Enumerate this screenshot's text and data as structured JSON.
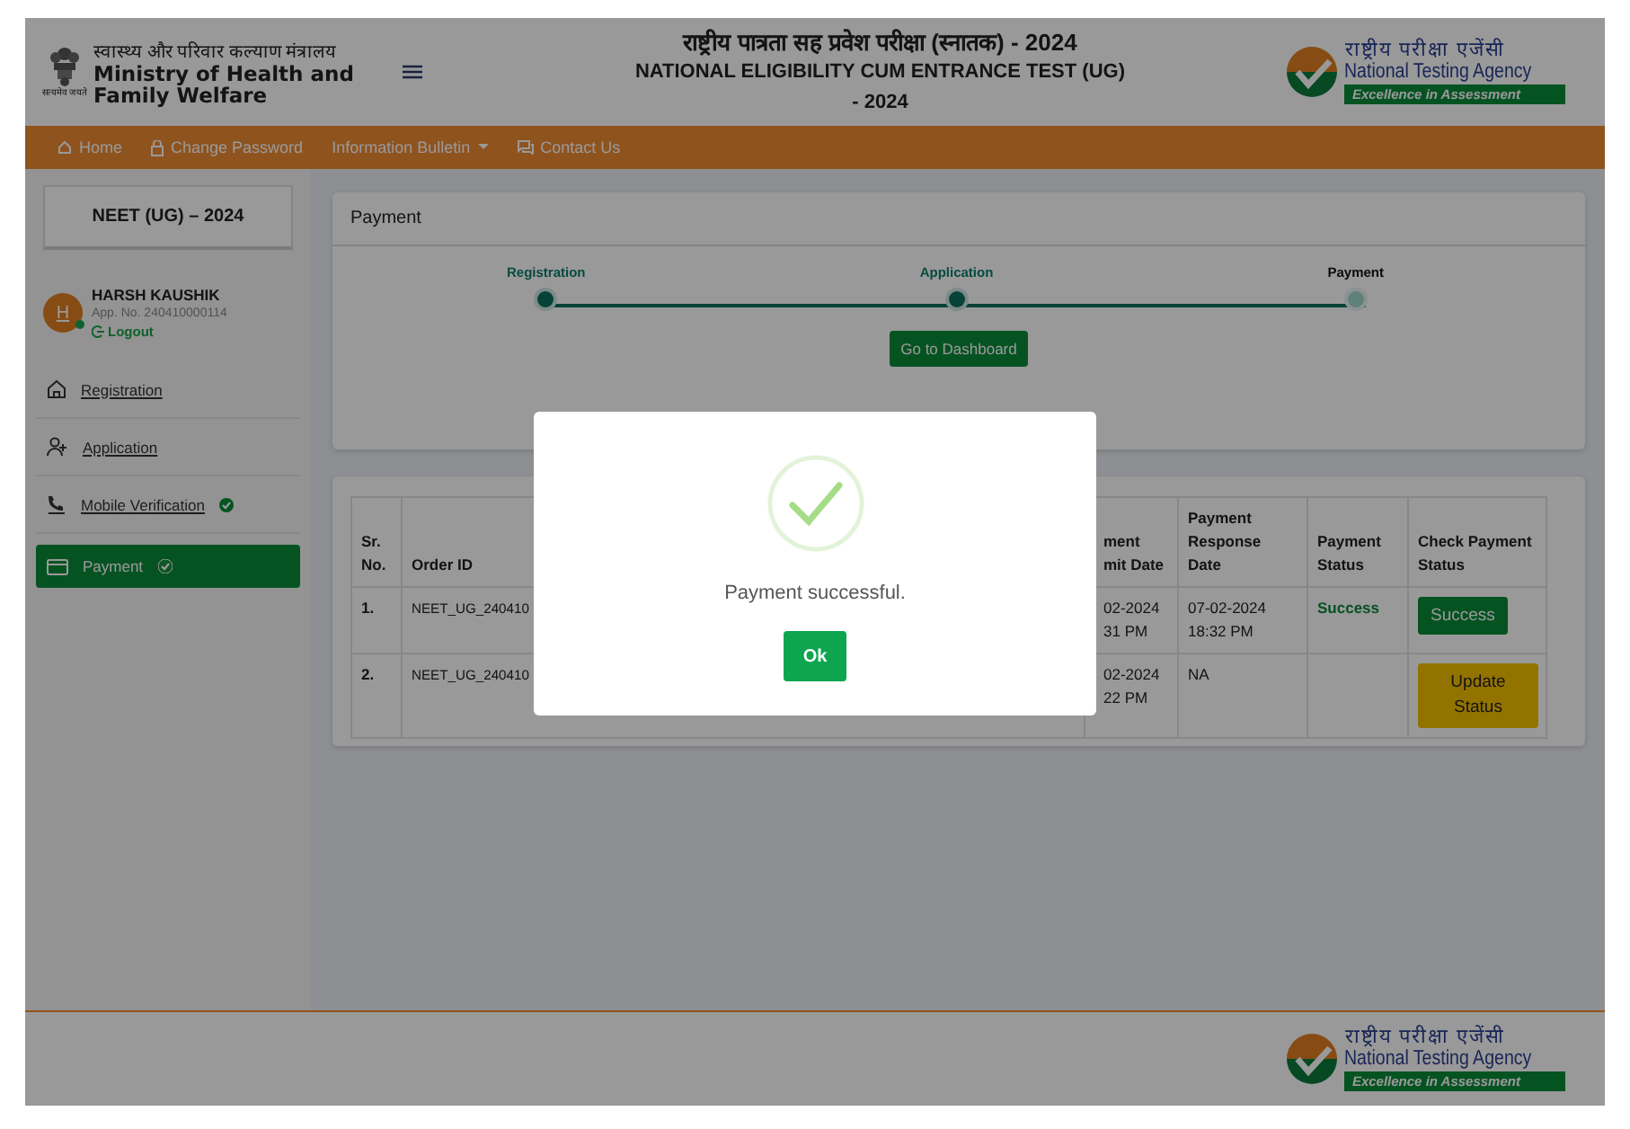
{
  "header": {
    "ministry": {
      "hindi": "स्वास्थ्य और परिवार कल्याण मंत्रालय",
      "english": "Ministry of Health and Family Welfare",
      "motto": "सत्यमेव जयते"
    },
    "title": {
      "hindi": "राष्ट्रीय पात्रता सह प्रवेश परीक्षा (स्नातक) - 2024",
      "line_1": "NATIONAL ELIGIBILITY CUM ENTRANCE TEST (UG)",
      "line_2": "- 2024"
    },
    "agency_logo": {
      "hindi": "राष्ट्रीय परीक्षा एजेंसी",
      "english": "National Testing Agency",
      "tagline": "Excellence in Assessment"
    }
  },
  "nav": [
    {
      "kind": "home",
      "label": "Home"
    },
    {
      "kind": "lock",
      "label": "Change Password"
    },
    {
      "kind": "dropdown",
      "label": "Information Bulletin"
    },
    {
      "kind": "chat",
      "label": "Contact Us"
    }
  ],
  "sidebar": {
    "exam": "NEET (UG) – 2024",
    "user": {
      "initial": "H",
      "name": "HARSH KAUSHIK",
      "app_no": "App. No. 240410000114",
      "online": true,
      "logout": "Logout"
    },
    "items": [
      {
        "kind": "home",
        "label": "Registration",
        "verified": false,
        "selected": false
      },
      {
        "kind": "user-plus",
        "label": "Application",
        "verified": false,
        "selected": false
      },
      {
        "kind": "phone",
        "label": "Mobile Verification",
        "verified": true,
        "selected": false
      },
      {
        "kind": "card",
        "label": "Payment",
        "verified": true,
        "selected": true
      }
    ]
  },
  "payment_card": {
    "title": "Payment",
    "steps": [
      {
        "label": "Registration",
        "done": true
      },
      {
        "label": "Application",
        "done": true
      },
      {
        "label": "Payment",
        "done": false
      }
    ],
    "button": "Go to Dashboard"
  },
  "table": {
    "columns": [
      "Sr. No.",
      "Order ID",
      "ment\nmit Date",
      "Payment Response Date",
      "Payment Status",
      "Check Payment Status"
    ],
    "rows": [
      {
        "sr": "1.",
        "order_id": "NEET_UG_240410",
        "submit_date": "02-2024\n31 PM",
        "response_date": "07-02-2024\n18:32 PM",
        "status": "Success",
        "check": {
          "kind": "success",
          "label": "Success"
        }
      },
      {
        "sr": "2.",
        "order_id": "NEET_UG_240410",
        "submit_date": "02-2024\n22 PM",
        "response_date": "NA",
        "check": {
          "kind": "update",
          "label": "Update Status"
        }
      }
    ]
  },
  "modal": {
    "message": "Payment successful.",
    "button": "Ok"
  },
  "footer": {
    "agency_logo": {
      "hindi": "राष्ट्रीय परीक्षा एजेंसी",
      "english": "National Testing Agency",
      "tagline": "Excellence in Assessment"
    }
  }
}
